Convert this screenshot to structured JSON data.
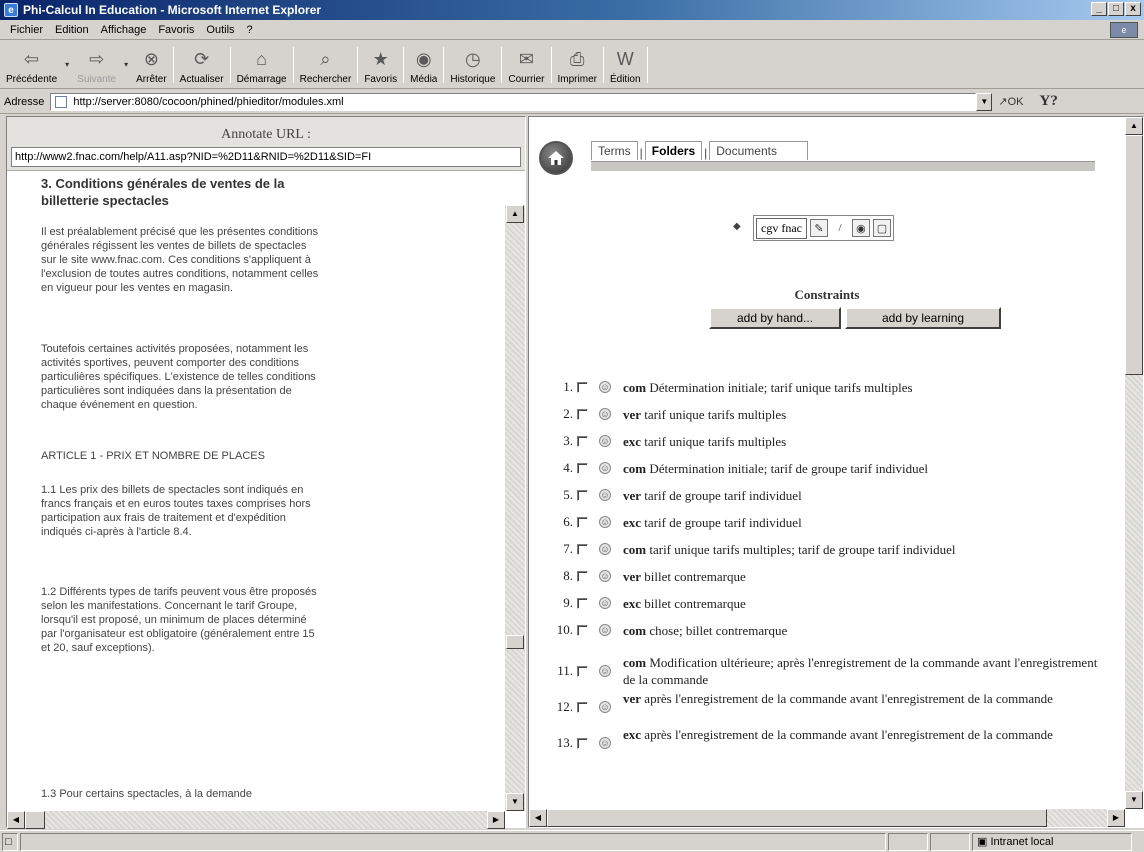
{
  "window": {
    "title": "Phi-Calcul In Education - Microsoft Internet Explorer",
    "controls": [
      "_",
      "□",
      "x"
    ]
  },
  "menu": [
    "Fichier",
    "Edition",
    "Affichage",
    "Favoris",
    "Outils",
    "?"
  ],
  "toolbar": {
    "buttons": [
      {
        "label": "Précédente",
        "icon": "back-arrow-icon",
        "glyph": "⇦"
      },
      {
        "label": "Suivante",
        "icon": "forward-arrow-icon",
        "glyph": "⇨"
      },
      {
        "label": "Arrêter",
        "icon": "stop-icon",
        "glyph": "⊗"
      },
      {
        "label": "Actualiser",
        "icon": "refresh-icon",
        "glyph": "⟳"
      },
      {
        "label": "Démarrage",
        "icon": "home-icon",
        "glyph": "⌂"
      },
      {
        "label": "Rechercher",
        "icon": "search-icon",
        "glyph": "⌕"
      },
      {
        "label": "Favoris",
        "icon": "favorites-icon",
        "glyph": "★"
      },
      {
        "label": "Média",
        "icon": "media-icon",
        "glyph": "◉"
      },
      {
        "label": "Historique",
        "icon": "history-icon",
        "glyph": "◷"
      },
      {
        "label": "Courrier",
        "icon": "mail-icon",
        "glyph": "✉"
      },
      {
        "label": "Imprimer",
        "icon": "print-icon",
        "glyph": "⎙"
      },
      {
        "label": "Édition",
        "icon": "edit-word-icon",
        "glyph": "W"
      }
    ]
  },
  "address": {
    "label": "Adresse",
    "url": "http://server:8080/cocoon/phined/phieditor/modules.xml",
    "go": "OK",
    "yahoo": "Y?"
  },
  "annotate": {
    "title": "Annotate URL :",
    "url": "http://www2.fnac.com/help/A11.asp?NID=%2D11&RNID=%2D11&SID=FI"
  },
  "document": {
    "heading": "3. Conditions générales de ventes de la billetterie spectacles",
    "paragraphs": [
      "Il est préalablement précisé que les présentes conditions générales régissent les ventes de billets de spectacles sur le site www.fnac.com. Ces conditions s'appliquent à l'exclusion de toutes autres conditions, notamment celles en vigueur pour les ventes en magasin.",
      "Toutefois certaines activités proposées, notamment les activités sportives, peuvent comporter des conditions particulières spécifiques. L'existence de telles conditions particulières sont indiquées dans la présentation de chaque événement en question.",
      "ARTICLE 1 - PRIX ET NOMBRE DE PLACES",
      "1.1 Les prix des billets de spectacles sont indiqués en francs français et en euros toutes taxes comprises hors participation aux frais de traitement et d'expédition indiqués ci-après à l'article 8.4.",
      "1.2 Différents types de tarifs peuvent vous être proposés selon les manifestations. Concernant le tarif Groupe, lorsqu'il est proposé, un minimum de places déterminé par l'organisateur est obligatoire (généralement entre 15 et 20, sauf exceptions).",
      "1.3 Pour certains spectacles, à la demande"
    ]
  },
  "tabs": {
    "terms": "Terms",
    "folders": "Folders",
    "documents": "Documents",
    "separator": "|"
  },
  "folder": {
    "bullet": "◆",
    "label": "cgv fnac",
    "icons": [
      "comment-icon",
      "pencil-icon",
      "view-icon",
      "open-folder-icon"
    ]
  },
  "constraints": {
    "title": "Constraints",
    "add_by_hand": "add by hand...",
    "add_by_learning": "add by learning",
    "items": [
      {
        "num": "1.",
        "type": "com",
        "text": "Détermination initiale; tarif unique tarifs multiples"
      },
      {
        "num": "2.",
        "type": "ver",
        "text": "tarif unique tarifs multiples"
      },
      {
        "num": "3.",
        "type": "exc",
        "text": "tarif unique tarifs multiples"
      },
      {
        "num": "4.",
        "type": "com",
        "text": "Détermination initiale; tarif de groupe tarif individuel"
      },
      {
        "num": "5.",
        "type": "ver",
        "text": "tarif de groupe tarif individuel"
      },
      {
        "num": "6.",
        "type": "exc",
        "text": "tarif de groupe tarif individuel"
      },
      {
        "num": "7.",
        "type": "com",
        "text": "tarif unique tarifs multiples; tarif de groupe tarif individuel"
      },
      {
        "num": "8.",
        "type": "ver",
        "text": "billet contremarque"
      },
      {
        "num": "9.",
        "type": "exc",
        "text": "billet contremarque"
      },
      {
        "num": "10.",
        "type": "com",
        "text": "chose; billet contremarque"
      },
      {
        "num": "11.",
        "type": "com",
        "text": "Modification ultérieure; après l'enregistrement de la commande avant l'enregistrement de la commande"
      },
      {
        "num": "12.",
        "type": "ver",
        "text": "après l'enregistrement de la commande avant l'enregistrement de la commande"
      },
      {
        "num": "13.",
        "type": "exc",
        "text": "après l'enregistrement de la commande avant l'enregistrement de la commande"
      }
    ]
  },
  "status": {
    "zone": "Intranet local"
  }
}
